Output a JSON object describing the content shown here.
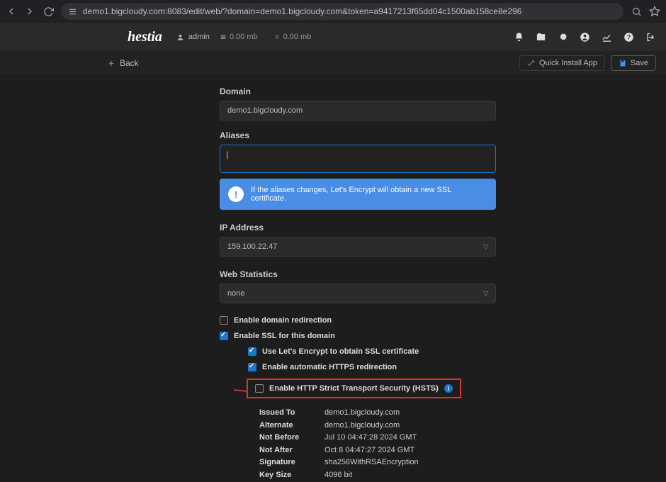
{
  "browser": {
    "url": "demo1.bigcloudy.com:8083/edit/web/?domain=demo1.bigcloudy.com&token=a9417213f65dd04c1500ab158ce8e296"
  },
  "header": {
    "user": "admin",
    "disk": "0.00 mb",
    "bw": "0.00 mb"
  },
  "toolbar": {
    "back": "Back",
    "quick": "Quick Install App",
    "save": "Save"
  },
  "form": {
    "domain_label": "Domain",
    "domain_value": "demo1.bigcloudy.com",
    "aliases_label": "Aliases",
    "aliases_value": "",
    "alert_text": "If the aliases changes, Let's Encrypt will obtain a new SSL certificate.",
    "ip_label": "IP Address",
    "ip_value": "159.100.22.47",
    "stats_label": "Web Statistics",
    "stats_value": "none",
    "chk_redir": "Enable domain redirection",
    "chk_ssl": "Enable SSL for this domain",
    "chk_le": "Use Let's Encrypt to obtain SSL certificate",
    "chk_https": "Enable automatic HTTPS redirection",
    "chk_hsts": "Enable HTTP Strict Transport Security (HSTS)"
  },
  "cert": {
    "issued_to_k": "Issued To",
    "issued_to_v": "demo1.bigcloudy.com",
    "alt_k": "Alternate",
    "alt_v": "demo1.bigcloudy.com",
    "nb_k": "Not Before",
    "nb_v": "Jul 10 04:47:28 2024 GMT",
    "na_k": "Not After",
    "na_v": "Oct 8 04:47:27 2024 GMT",
    "sig_k": "Signature",
    "sig_v": "sha256WithRSAEncryption",
    "key_k": "Key Size",
    "key_v": "4096 bit"
  }
}
